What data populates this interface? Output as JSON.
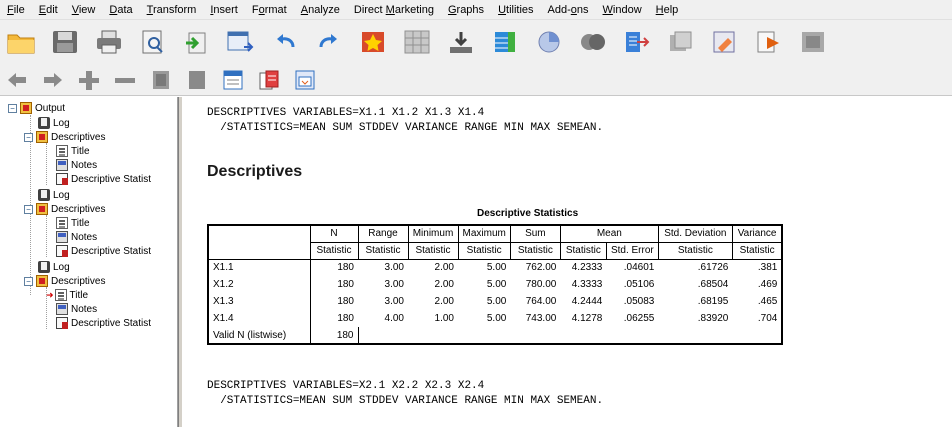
{
  "menu": [
    {
      "pre": "",
      "ul": "F",
      "post": "ile"
    },
    {
      "pre": "",
      "ul": "E",
      "post": "dit"
    },
    {
      "pre": "",
      "ul": "V",
      "post": "iew"
    },
    {
      "pre": "",
      "ul": "D",
      "post": "ata"
    },
    {
      "pre": "",
      "ul": "T",
      "post": "ransform"
    },
    {
      "pre": "",
      "ul": "I",
      "post": "nsert"
    },
    {
      "pre": "F",
      "ul": "o",
      "post": "rmat"
    },
    {
      "pre": "",
      "ul": "A",
      "post": "nalyze"
    },
    {
      "pre": "Direct ",
      "ul": "M",
      "post": "arketing"
    },
    {
      "pre": "",
      "ul": "G",
      "post": "raphs"
    },
    {
      "pre": "",
      "ul": "U",
      "post": "tilities"
    },
    {
      "pre": "Add-",
      "ul": "o",
      "post": "ns"
    },
    {
      "pre": "",
      "ul": "W",
      "post": "indow"
    },
    {
      "pre": "",
      "ul": "H",
      "post": "elp"
    }
  ],
  "outline": {
    "root": "Output",
    "log": "Log",
    "descriptives": "Descriptives",
    "title": "Title",
    "notes": "Notes",
    "desc_stats": "Descriptive Statist"
  },
  "syntax1": {
    "line1": "DESCRIPTIVES VARIABLES=X1.1 X1.2 X1.3 X1.4",
    "line2": "  /STATISTICS=MEAN SUM STDDEV VARIANCE RANGE MIN MAX SEMEAN."
  },
  "heading": "Descriptives",
  "table": {
    "caption": "Descriptive Statistics",
    "headers": [
      "N",
      "Range",
      "Minimum",
      "Maximum",
      "Sum",
      "Mean",
      "Std. Deviation",
      "Variance"
    ],
    "subheaders": [
      "Statistic",
      "Statistic",
      "Statistic",
      "Statistic",
      "Statistic",
      "Statistic",
      "Std. Error",
      "Statistic",
      "Statistic"
    ],
    "rows": [
      {
        "label": "X1.1",
        "values": [
          "180",
          "3.00",
          "2.00",
          "5.00",
          "762.00",
          "4.2333",
          ".04601",
          ".61726",
          ".381"
        ]
      },
      {
        "label": "X1.2",
        "values": [
          "180",
          "3.00",
          "2.00",
          "5.00",
          "780.00",
          "4.3333",
          ".05106",
          ".68504",
          ".469"
        ]
      },
      {
        "label": "X1.3",
        "values": [
          "180",
          "3.00",
          "2.00",
          "5.00",
          "764.00",
          "4.2444",
          ".05083",
          ".68195",
          ".465"
        ]
      },
      {
        "label": "X1.4",
        "values": [
          "180",
          "4.00",
          "1.00",
          "5.00",
          "743.00",
          "4.1278",
          ".06255",
          ".83920",
          ".704"
        ]
      },
      {
        "label": "Valid N (listwise)",
        "values": [
          "180",
          "",
          "",
          "",
          "",
          "",
          "",
          "",
          ""
        ]
      }
    ]
  },
  "syntax2": {
    "line1": "DESCRIPTIVES VARIABLES=X2.1 X2.2 X2.3 X2.4",
    "line2": "  /STATISTICS=MEAN SUM STDDEV VARIANCE RANGE MIN MAX SEMEAN."
  }
}
